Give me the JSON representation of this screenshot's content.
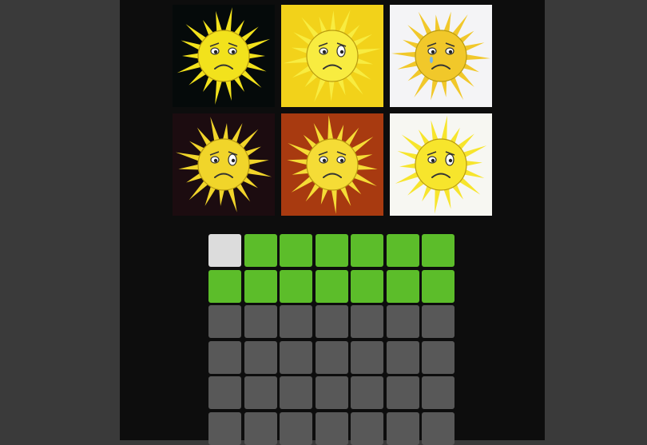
{
  "colors": {
    "page_bg": "#3a3a3a",
    "panel_bg": "#0d0d0d",
    "wrong": "#dcdcdc",
    "correct": "#5cbd2a",
    "empty": "#585858"
  },
  "images": [
    {
      "icon": "sad-sun-icon",
      "bg": "#050a0a",
      "sun": "#f2e21c"
    },
    {
      "icon": "sad-sun-icon",
      "bg": "#f2d21a",
      "sun": "#f8ec40"
    },
    {
      "icon": "crying-sun-icon",
      "bg": "#f4f4f6",
      "sun": "#f1c82a"
    },
    {
      "icon": "worried-sun-icon",
      "bg": "#1c0c10",
      "sun": "#f1d52a"
    },
    {
      "icon": "sad-sun-icon",
      "bg": "#a83a10",
      "sun": "#f5dc36"
    },
    {
      "icon": "worried-sun-icon",
      "bg": "#f7f7f2",
      "sun": "#f7e52c"
    }
  ],
  "board": {
    "columns": 7,
    "rows": [
      [
        "wrong",
        "correct",
        "correct",
        "correct",
        "correct",
        "correct",
        "correct"
      ],
      [
        "correct",
        "correct",
        "correct",
        "correct",
        "correct",
        "correct",
        "correct"
      ],
      [
        "empty",
        "empty",
        "empty",
        "empty",
        "empty",
        "empty",
        "empty"
      ],
      [
        "empty",
        "empty",
        "empty",
        "empty",
        "empty",
        "empty",
        "empty"
      ],
      [
        "empty",
        "empty",
        "empty",
        "empty",
        "empty",
        "empty",
        "empty"
      ],
      [
        "empty",
        "empty",
        "empty",
        "empty",
        "empty",
        "empty",
        "empty"
      ]
    ]
  }
}
